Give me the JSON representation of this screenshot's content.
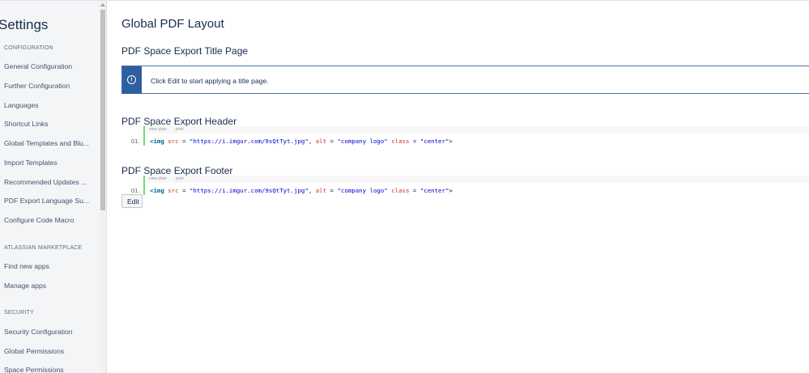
{
  "sidebar": {
    "title": "Settings",
    "sections": [
      {
        "heading": "CONFIGURATION",
        "items": [
          "General Configuration",
          "Further Configuration",
          "Languages",
          "Shortcut Links",
          "Global Templates and Blu...",
          "Import Templates",
          "Recommended Updates ...",
          "PDF Export Language Su...",
          "Configure Code Macro"
        ]
      },
      {
        "heading": "ATLASSIAN MARKETPLACE",
        "items": [
          "Find new apps",
          "Manage apps"
        ]
      },
      {
        "heading": "SECURITY",
        "items": [
          "Security Configuration",
          "Global Permissions",
          "Space Permissions"
        ]
      }
    ]
  },
  "main": {
    "title": "Global PDF Layout",
    "title_page": {
      "heading": "PDF Space Export Title Page",
      "info_icon": "info-icon",
      "info_text": "Click Edit to start applying a title page."
    },
    "header": {
      "heading": "PDF Space Export Header",
      "tool_view_plain": "view plain",
      "tool_print": "print",
      "line_no": "01.",
      "code": {
        "tag": "<img",
        "a1": "src",
        "eq": " = ",
        "v1": "\"https://i.imgur.com/9sQtTyt.jpg\"",
        "comma": ", ",
        "a2": "alt",
        "v2": "\"company logo\"",
        "a3": "class",
        "v3": "\"center\"",
        "end": ">"
      }
    },
    "footer": {
      "heading": "PDF Space Export Footer",
      "tool_view_plain": "view plain",
      "tool_print": "print",
      "line_no": "01.",
      "code": {
        "tag": "<img",
        "a1": "src",
        "eq": " = ",
        "v1": "\"https://i.imgur.com/9sQtTyt.jpg\"",
        "comma": ", ",
        "a2": "alt",
        "v2": "\"company logo\"",
        "a3": "class",
        "v3": "\"center\"",
        "end": ">"
      }
    },
    "edit_label": "Edit"
  },
  "colors": {
    "info_accent": "#2d5fa0",
    "code_gutter": "#6ce26c",
    "code_tag": "#006699",
    "code_attr": "#cc3333",
    "code_string": "#0000cc"
  }
}
